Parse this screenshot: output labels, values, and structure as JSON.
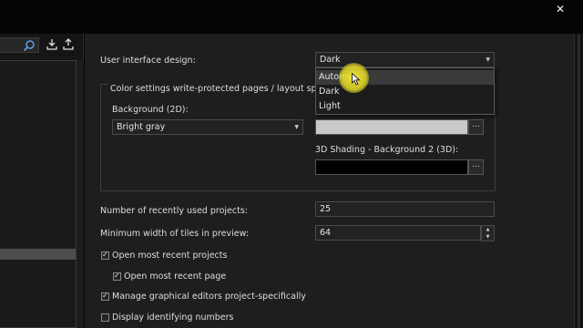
{
  "window": {
    "close_glyph": "✕"
  },
  "left_panel": {
    "search_icon": "search-icon",
    "import_icon": "download-icon",
    "export_icon": "upload-icon"
  },
  "settings": {
    "ui_design": {
      "label": "User interface design:",
      "value": "Dark",
      "options": [
        "Automatic",
        "Dark",
        "Light"
      ],
      "hovered": "Automatic"
    },
    "color_group": {
      "title": "Color settings write-protected pages / layout spaces",
      "bg2d": {
        "label": "Background (2D):",
        "value": "Bright gray"
      },
      "shading_bg1": {
        "color": "#c9c9c9"
      },
      "shading_bg2": {
        "label": "3D Shading - Background 2 (3D):",
        "color": "#000000"
      }
    },
    "recent_projects": {
      "label": "Number of recently used projects:",
      "value": "25"
    },
    "min_tile_width": {
      "label": "Minimum width of tiles in preview:",
      "value": "64"
    },
    "checkboxes": {
      "open_recent_projects": {
        "label": "Open most recent projects",
        "checked": true
      },
      "open_recent_page": {
        "label": "Open most recent page",
        "checked": true
      },
      "manage_editors": {
        "label": "Manage graphical editors project-specifically",
        "checked": true
      },
      "display_ids": {
        "label": "Display identifying numbers",
        "checked": false
      }
    }
  },
  "colors": {
    "highlight": "#e8dc32",
    "panel": "#1e1e1e"
  }
}
